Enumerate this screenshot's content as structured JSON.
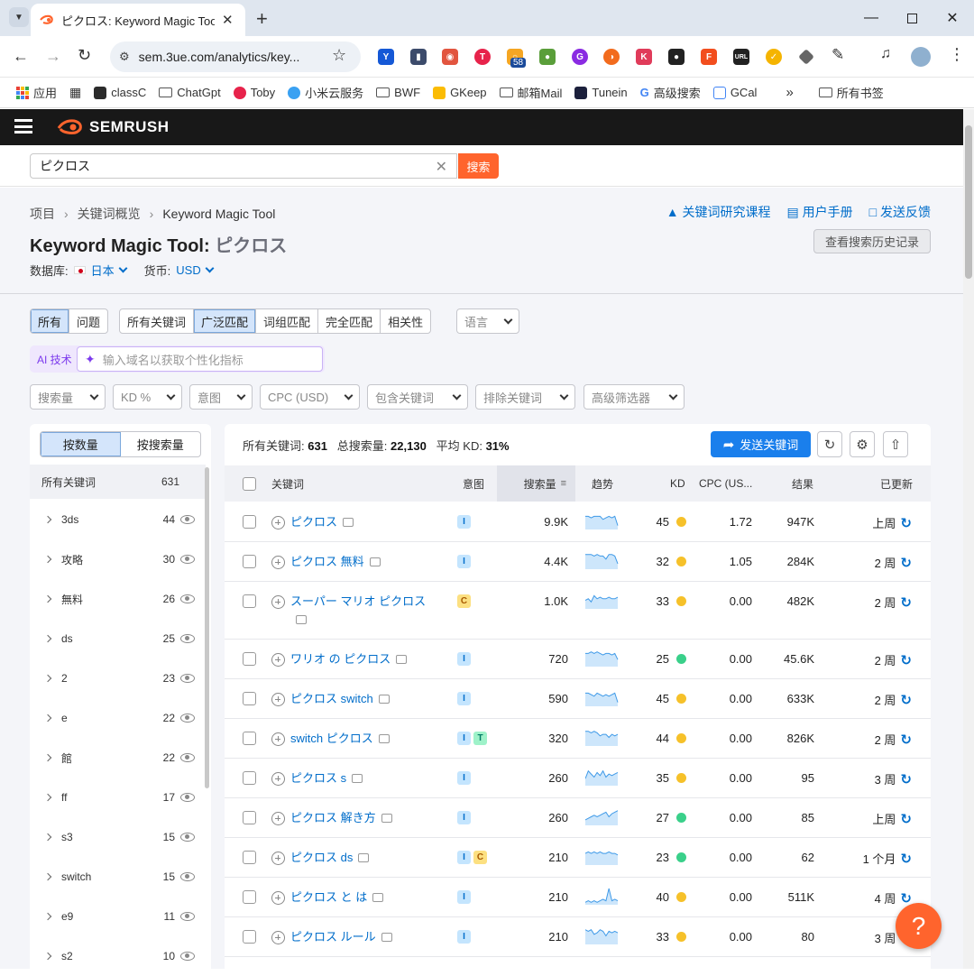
{
  "browser": {
    "tab_title": "ピクロス: Keyword Magic Tool",
    "url": "sem.3ue.com/analytics/key...",
    "ext_badge": "58",
    "bookmarks": [
      {
        "label": "应用",
        "icon": "apps-icon"
      },
      {
        "label": "classC",
        "icon": "classc-icon"
      },
      {
        "label": "ChatGpt",
        "icon": "folder-icon"
      },
      {
        "label": "Toby",
        "icon": "toby-icon"
      },
      {
        "label": "小米云服务",
        "icon": "cloud-icon"
      },
      {
        "label": "BWF",
        "icon": "folder-icon"
      },
      {
        "label": "GKeep",
        "icon": "keep-icon"
      },
      {
        "label": "邮箱Mail",
        "icon": "folder-icon"
      },
      {
        "label": "Tunein",
        "icon": "tunein-icon"
      },
      {
        "label": "高级搜索",
        "icon": "google-icon"
      },
      {
        "label": "GCal",
        "icon": "calendar-icon"
      }
    ],
    "bookmarks_more": "»",
    "all_bookmarks": "所有书签"
  },
  "header": {
    "logo": "SEMRUSH"
  },
  "search": {
    "value": "ピクロス",
    "button": "搜索"
  },
  "breadcrumb": [
    "项目",
    "关键词概览",
    "Keyword Magic Tool"
  ],
  "page": {
    "title": "Keyword Magic Tool:",
    "query": "ピクロス"
  },
  "db": {
    "label": "数据库:",
    "value": "日本",
    "currency_label": "货币:",
    "currency": "USD"
  },
  "links": {
    "course": "关键词研究课程",
    "manual": "用户手册",
    "feedback": "发送反馈"
  },
  "history_btn": "查看搜索历史记录",
  "match_tabs": {
    "all": "所有",
    "questions": "问题",
    "all_kw": "所有关键词",
    "broad": "广泛匹配",
    "phrase": "词组匹配",
    "exact": "完全匹配",
    "related": "相关性"
  },
  "lang": "语言",
  "ai": {
    "tag": "AI 技术",
    "placeholder": "输入域名以获取个性化指标"
  },
  "filters": [
    "搜索量",
    "KD %",
    "意图",
    "CPC (USD)",
    "包含关键词",
    "排除关键词",
    "高级筛选器"
  ],
  "groups": {
    "by_count": "按数量",
    "by_volume": "按搜索量",
    "all_label": "所有关键词",
    "all_count": "631",
    "items": [
      {
        "name": "3ds",
        "count": "44"
      },
      {
        "name": "攻略",
        "count": "30"
      },
      {
        "name": "無料",
        "count": "26"
      },
      {
        "name": "ds",
        "count": "25"
      },
      {
        "name": "2",
        "count": "23"
      },
      {
        "name": "e",
        "count": "22"
      },
      {
        "name": "館",
        "count": "22"
      },
      {
        "name": "ff",
        "count": "17"
      },
      {
        "name": "s3",
        "count": "15"
      },
      {
        "name": "switch",
        "count": "15"
      },
      {
        "name": "e9",
        "count": "11"
      },
      {
        "name": "s2",
        "count": "10"
      }
    ]
  },
  "summary": {
    "kw_label": "所有关键词:",
    "kw": "631",
    "vol_label": "总搜索量:",
    "vol": "22,130",
    "kd_label": "平均 KD:",
    "kd": "31%"
  },
  "send_btn": "发送关键词",
  "columns": {
    "keyword": "关键词",
    "intent": "意图",
    "volume": "搜索量",
    "trend": "趋势",
    "kd": "KD",
    "cpc": "CPC (US...",
    "results": "结果",
    "updated": "已更新"
  },
  "colors": {
    "orange": "#ff642d",
    "blue": "#006dca",
    "kd_yellow": "#f6c12a",
    "kd_green": "#3ad08a"
  },
  "rows": [
    {
      "kw": "ピクロス",
      "intents": [
        "I"
      ],
      "vol": "9.9K",
      "kd": "45",
      "kdc": "#f6c12a",
      "cpc": "1.72",
      "res": "947K",
      "upd": "上周",
      "trend": [
        8,
        8,
        7,
        8,
        8,
        8,
        6,
        7,
        8,
        7,
        8,
        2
      ]
    },
    {
      "kw": "ピクロス 無料",
      "intents": [
        "I"
      ],
      "vol": "4.4K",
      "kd": "32",
      "kdc": "#f6c12a",
      "cpc": "1.05",
      "res": "284K",
      "upd": "2 周",
      "trend": [
        9,
        9,
        9,
        8,
        9,
        8,
        8,
        6,
        9,
        9,
        8,
        3
      ]
    },
    {
      "kw": "スーパー マリオ ピクロス",
      "intents": [
        "C"
      ],
      "vol": "1.0K",
      "kd": "33",
      "kdc": "#f6c12a",
      "cpc": "0.00",
      "res": "482K",
      "upd": "2 周",
      "trend": [
        5,
        6,
        4,
        8,
        6,
        7,
        6,
        6,
        7,
        6,
        6,
        7
      ]
    },
    {
      "kw": "ワリオ の ピクロス",
      "intents": [
        "I"
      ],
      "vol": "720",
      "kd": "25",
      "kdc": "#3ad08a",
      "cpc": "0.00",
      "res": "45.6K",
      "upd": "2 周",
      "trend": [
        8,
        8,
        9,
        8,
        9,
        8,
        7,
        8,
        8,
        7,
        8,
        4
      ]
    },
    {
      "kw": "ピクロス switch",
      "intents": [
        "I"
      ],
      "vol": "590",
      "kd": "45",
      "kdc": "#f6c12a",
      "cpc": "0.00",
      "res": "633K",
      "upd": "2 周",
      "trend": [
        8,
        8,
        7,
        6,
        8,
        7,
        6,
        7,
        6,
        7,
        8,
        2
      ]
    },
    {
      "kw": "switch ピクロス",
      "intents": [
        "I",
        "T"
      ],
      "vol": "320",
      "kd": "44",
      "kdc": "#f6c12a",
      "cpc": "0.00",
      "res": "826K",
      "upd": "2 周",
      "trend": [
        9,
        9,
        8,
        9,
        8,
        6,
        7,
        7,
        5,
        7,
        6,
        7
      ]
    },
    {
      "kw": "ピクロス s",
      "intents": [
        "I"
      ],
      "vol": "260",
      "kd": "35",
      "kdc": "#f6c12a",
      "cpc": "0.00",
      "res": "95",
      "upd": "3 周",
      "trend": [
        4,
        9,
        7,
        5,
        8,
        6,
        9,
        5,
        7,
        6,
        7,
        8
      ]
    },
    {
      "kw": "ピクロス 解き方",
      "intents": [
        "I"
      ],
      "vol": "260",
      "kd": "27",
      "kdc": "#3ad08a",
      "cpc": "0.00",
      "res": "85",
      "upd": "上周",
      "trend": [
        3,
        4,
        5,
        6,
        5,
        6,
        7,
        8,
        5,
        7,
        8,
        9
      ]
    },
    {
      "kw": "ピクロス ds",
      "intents": [
        "I",
        "C"
      ],
      "vol": "210",
      "kd": "23",
      "kdc": "#3ad08a",
      "cpc": "0.00",
      "res": "62",
      "upd": "1 个月",
      "trend": [
        7,
        8,
        7,
        8,
        7,
        8,
        7,
        7,
        8,
        7,
        7,
        6
      ]
    },
    {
      "kw": "ピクロス と は",
      "intents": [
        "I"
      ],
      "vol": "210",
      "kd": "40",
      "kdc": "#f6c12a",
      "cpc": "0.00",
      "res": "511K",
      "upd": "4 周",
      "trend": [
        1,
        2,
        1,
        2,
        1,
        2,
        3,
        2,
        10,
        2,
        3,
        2
      ]
    },
    {
      "kw": "ピクロス ルール",
      "intents": [
        "I"
      ],
      "vol": "210",
      "kd": "33",
      "kdc": "#f6c12a",
      "cpc": "0.00",
      "res": "80",
      "upd": "3 周",
      "trend": [
        9,
        8,
        9,
        6,
        7,
        9,
        8,
        5,
        8,
        7,
        8,
        7
      ]
    }
  ],
  "help": "?"
}
